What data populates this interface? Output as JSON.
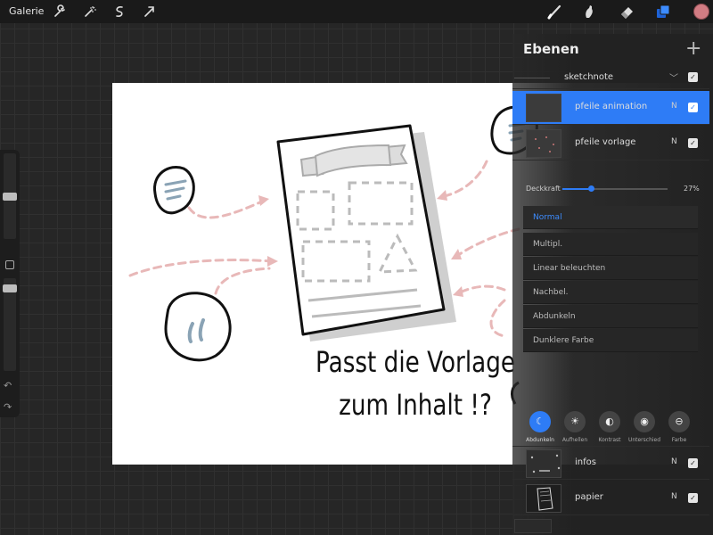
{
  "toolbar": {
    "gallery_label": "Galerie",
    "left_tools": [
      "wrench-icon",
      "magic-wand-icon",
      "selection-icon",
      "transform-arrow-icon"
    ],
    "right_tools": [
      "brush-icon",
      "smudge-icon",
      "eraser-icon",
      "layers-icon"
    ],
    "color_swatch": "#d27c83"
  },
  "canvas": {
    "title_line1": "Passt die Vorlage",
    "title_line2": "zum Inhalt !?"
  },
  "layers_panel": {
    "title": "Ebenen",
    "add_icon": "+",
    "layers": [
      {
        "name": "sketchnote",
        "blend": "",
        "visible": true,
        "group": true
      },
      {
        "name": "pfeile animation",
        "blend": "N",
        "visible": true,
        "selected": true
      },
      {
        "name": "pfeile vorlage",
        "blend": "N",
        "visible": true
      }
    ],
    "opacity_label": "Deckkraft",
    "opacity_value": "27%",
    "opacity_fraction": 0.27,
    "blend_modes": [
      "Normal",
      "Multipl.",
      "Linear beleuchten",
      "Nachbel.",
      "Abdunkeln",
      "Dunklere Farbe"
    ],
    "blend_active": "Normal",
    "mode_categories": [
      {
        "label": "Abdunkeln",
        "icon": "moon-icon",
        "active": true
      },
      {
        "label": "Aufhellen",
        "icon": "sun-icon",
        "active": false
      },
      {
        "label": "Kontrast",
        "icon": "contrast-icon",
        "active": false
      },
      {
        "label": "Unterschied",
        "icon": "difference-icon",
        "active": false
      },
      {
        "label": "Farbe",
        "icon": "color-icon",
        "active": false
      }
    ],
    "bottom_layers": [
      {
        "name": "infos",
        "blend": "N",
        "visible": true
      },
      {
        "name": "papier",
        "blend": "N",
        "visible": true
      }
    ]
  },
  "colors": {
    "accent": "#2e7cf6",
    "arrow": "#e8b8b8",
    "stroke": "#111111",
    "shadow": "#cfcfcf"
  }
}
